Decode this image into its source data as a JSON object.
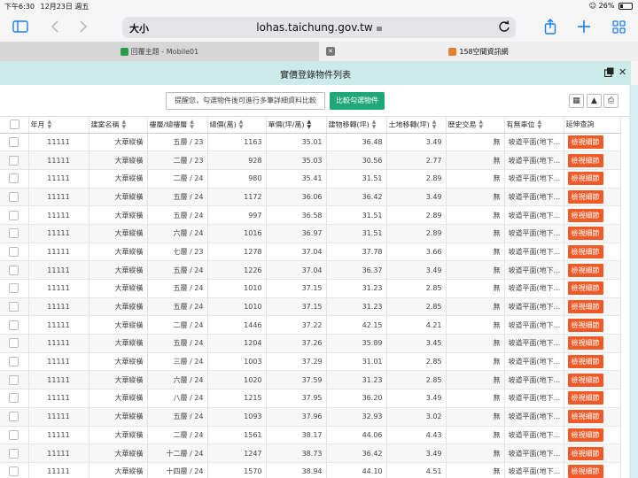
{
  "status": {
    "time": "下午6:30",
    "date": "12月23日 週五",
    "battery": "26%",
    "battery_level": 0.26
  },
  "browser": {
    "aa_label": "大小",
    "url": "lohas.taichung.gov.tw"
  },
  "tabs": [
    {
      "label": "回覆主題 - Mobile01",
      "favicon_color": "#2a9d4a"
    },
    {
      "label": "158空間資訊網",
      "favicon_color": "#e08030"
    }
  ],
  "modal": {
    "title": "實價登錄物件列表"
  },
  "toolbar": {
    "hint": "提醒您，勾選物件後可進行多筆詳細資料比較",
    "compare_button": "比較勾選物件"
  },
  "table": {
    "headers": [
      "年月",
      "建案名稱",
      "樓層/總樓層",
      "總價(萬)",
      "單價(坪/萬)",
      "建物移轉(坪)",
      "土地移轉(坪)",
      "歷史交易",
      "有無車位",
      "延伸查詢"
    ],
    "sorted_column": 4,
    "detail_label": "檢視細節",
    "rows": [
      [
        "11111",
        "大華縱橫",
        "五層 / 23",
        "1163",
        "35.01",
        "36.48",
        "3.49",
        "無",
        "坡道平面(地下..."
      ],
      [
        "11111",
        "大華縱橫",
        "二層 / 23",
        "928",
        "35.03",
        "30.56",
        "2.77",
        "無",
        "坡道平面(地下..."
      ],
      [
        "11111",
        "大華縱橫",
        "二層 / 24",
        "980",
        "35.41",
        "31.51",
        "2.89",
        "無",
        "坡道平面(地下..."
      ],
      [
        "11111",
        "大華縱橫",
        "五層 / 24",
        "1172",
        "36.06",
        "36.42",
        "3.49",
        "無",
        "坡道平面(地下..."
      ],
      [
        "11111",
        "大華縱橫",
        "五層 / 24",
        "997",
        "36.58",
        "31.51",
        "2.89",
        "無",
        "坡道平面(地下..."
      ],
      [
        "11111",
        "大華縱橫",
        "六層 / 24",
        "1016",
        "36.97",
        "31.51",
        "2.89",
        "無",
        "坡道平面(地下..."
      ],
      [
        "11111",
        "大華縱橫",
        "七層 / 23",
        "1278",
        "37.04",
        "37.78",
        "3.66",
        "無",
        "坡道平面(地下..."
      ],
      [
        "11111",
        "大華縱橫",
        "五層 / 24",
        "1226",
        "37.04",
        "36.37",
        "3.49",
        "無",
        "坡道平面(地下..."
      ],
      [
        "11111",
        "大華縱橫",
        "五層 / 24",
        "1010",
        "37.15",
        "31.23",
        "2.85",
        "無",
        "坡道平面(地下..."
      ],
      [
        "11111",
        "大華縱橫",
        "五層 / 24",
        "1010",
        "37.15",
        "31.23",
        "2.85",
        "無",
        "坡道平面(地下..."
      ],
      [
        "11111",
        "大華縱橫",
        "二層 / 24",
        "1446",
        "37.22",
        "42.15",
        "4.21",
        "無",
        "坡道平面(地下..."
      ],
      [
        "11111",
        "大華縱橫",
        "五層 / 24",
        "1204",
        "37.26",
        "35.89",
        "3.45",
        "無",
        "坡道平面(地下..."
      ],
      [
        "11111",
        "大華縱橫",
        "三層 / 24",
        "1003",
        "37.29",
        "31.01",
        "2.85",
        "無",
        "坡道平面(地下..."
      ],
      [
        "11111",
        "大華縱橫",
        "六層 / 24",
        "1020",
        "37.59",
        "31.23",
        "2.85",
        "無",
        "坡道平面(地下..."
      ],
      [
        "11111",
        "大華縱橫",
        "八層 / 24",
        "1215",
        "37.95",
        "36.20",
        "3.49",
        "無",
        "坡道平面(地下..."
      ],
      [
        "11111",
        "大華縱橫",
        "五層 / 24",
        "1093",
        "37.96",
        "32.93",
        "3.02",
        "無",
        "坡道平面(地下..."
      ],
      [
        "11111",
        "大華縱橫",
        "二層 / 24",
        "1561",
        "38.17",
        "44.06",
        "4.43",
        "無",
        "坡道平面(地下..."
      ],
      [
        "11111",
        "大華縱橫",
        "十二層 / 24",
        "1247",
        "38.73",
        "36.42",
        "3.49",
        "無",
        "坡道平面(地下..."
      ],
      [
        "11111",
        "大華縱橫",
        "十四層 / 24",
        "1570",
        "38.94",
        "44.10",
        "4.51",
        "無",
        "坡道平面(地下..."
      ]
    ]
  }
}
